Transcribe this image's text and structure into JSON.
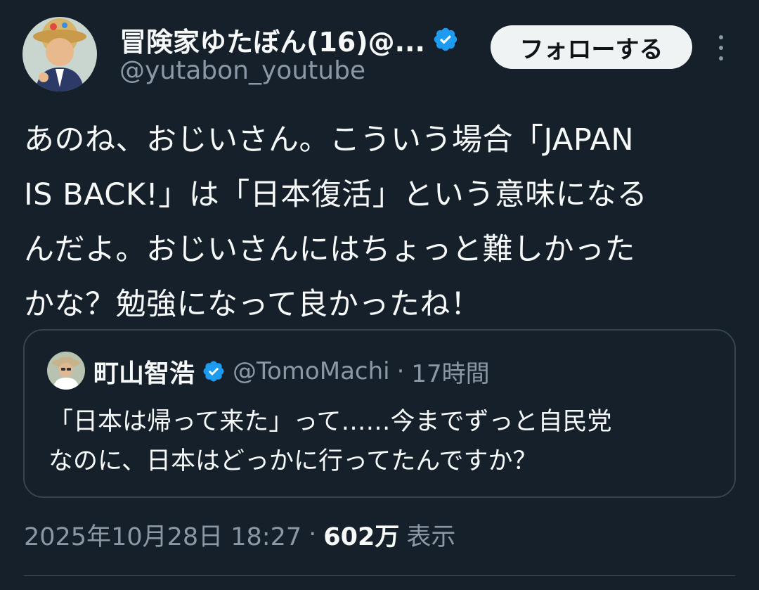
{
  "author": {
    "name": "冒険家ゆたぼん(16)@...",
    "handle": "@yutabon_youtube",
    "verified": true
  },
  "follow_button_label": "フォローする",
  "tweet_text": "あのね、おじいさん。こういう場合「JAPAN\nIS BACK!」は「日本復活」という意味になる\nんだよ。おじいさんにはちょっと難しかった\nかな？勉強になって良かったね！",
  "quoted_tweet": {
    "name": "町山智浩",
    "handle": "@TomoMachi",
    "separator": "·",
    "time": "17時間",
    "verified": true,
    "text": "「日本は帰って来た」って……今までずっと自民党\nなのに、日本はどっかに行ってたんですか？"
  },
  "meta": {
    "date": "2025年10月28日 18:27",
    "separator": "·",
    "views": "602万",
    "views_label": "表示"
  },
  "colors": {
    "background": "#15202b",
    "text_primary": "#f7f9f9",
    "text_secondary": "#8b98a5",
    "verified": "#1d9bf0",
    "border": "#38444d",
    "button_bg": "#eff3f4",
    "button_text": "#0f1419"
  },
  "icons": {
    "author_avatar": "avatar-icon",
    "verified": "verified-badge-icon",
    "more": "more-options-icon",
    "quote_avatar": "avatar-icon"
  }
}
